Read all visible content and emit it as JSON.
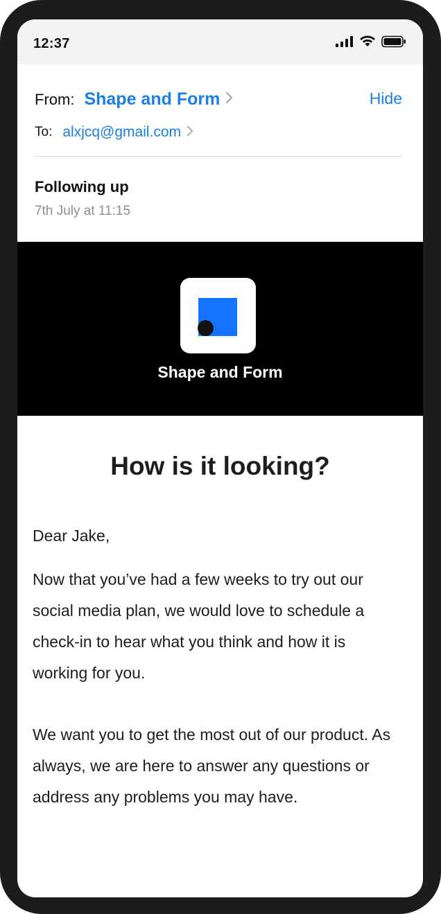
{
  "status_bar": {
    "time": "12:37"
  },
  "header": {
    "from_label": "From:",
    "from_value": "Shape and Form",
    "hide_label": "Hide",
    "to_label": "To:",
    "to_value": "alxjcq@gmail.com",
    "subject": "Following up",
    "date": "7th July at 11:15"
  },
  "banner": {
    "brand_name": "Shape and Form",
    "logo_color": "#1473FF"
  },
  "body": {
    "headline": "How is it looking?",
    "greeting": "Dear Jake,",
    "paragraph_1": "Now that you’ve had a few weeks to try out our social media plan, we would love to schedule a check-in to hear what you think and how it is working for you.",
    "paragraph_2": "We want you to get the most out of our product. As always, we are here to answer any questions or address any problems you may have."
  },
  "colors": {
    "accent": "#1A7EE6",
    "banner_bg": "#000000",
    "text": "#1D1D1F",
    "muted": "#8E8E93"
  },
  "icons": [
    "signal-icon",
    "wifi-icon",
    "battery-icon",
    "chevron-right-icon"
  ]
}
